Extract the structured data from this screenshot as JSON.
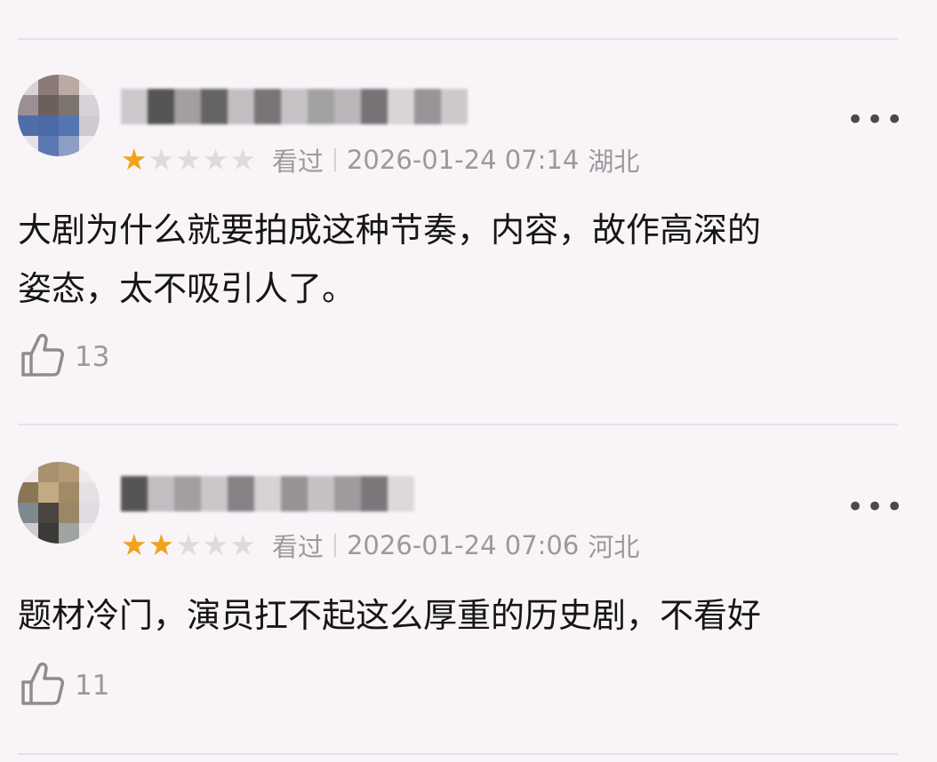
{
  "reviews": [
    {
      "rating": 1,
      "watched_label": "看过",
      "datetime": "2026-01-24 07:14",
      "region": "湖北",
      "content_line1": "大剧为什么就要拍成这种节奏，内容，故作高深的",
      "content_line2": "姿态，太不吸引人了。",
      "likes": "13",
      "more_label": "•••"
    },
    {
      "rating": 2,
      "watched_label": "看过",
      "datetime": "2026-01-24 07:06",
      "region": "河北",
      "content_line1": "题材冷门，演员扛不起这么厚重的历史剧，不看好",
      "likes": "11",
      "more_label": "•••"
    }
  ],
  "icons": {
    "like": "thumbs-up-icon",
    "more": "more-dots-icon",
    "star": "star-icon"
  },
  "colors": {
    "background": "#f8f4f8",
    "star_active": "#f1a21c",
    "star_inactive": "#dedade",
    "meta_text": "#9c989c"
  }
}
